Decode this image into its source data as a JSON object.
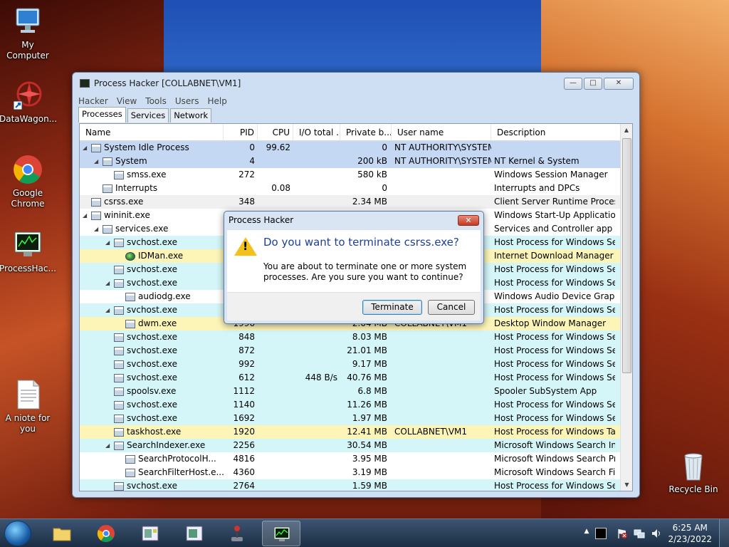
{
  "desktop": {
    "icons": [
      {
        "label": "My Computer"
      },
      {
        "label": "DataWagon..."
      },
      {
        "label": "Google Chrome"
      },
      {
        "label": "ProcessHac..."
      },
      {
        "label": "A niote for you"
      },
      {
        "label": "Recycle Bin"
      }
    ]
  },
  "window": {
    "title": "Process Hacker [COLLABNET\\VM1]",
    "menu": [
      "Hacker",
      "View",
      "Tools",
      "Users",
      "Help"
    ],
    "tabs": [
      "Processes",
      "Services",
      "Network"
    ],
    "columns": [
      "Name",
      "PID",
      "CPU",
      "I/O total ...",
      "Private b...",
      "User name",
      "Description"
    ],
    "rows": [
      {
        "name": "System Idle Process",
        "pid": "0",
        "cpu": "99.62",
        "io": "",
        "priv": "0",
        "user": "NT AUTHORITY\\SYSTEM",
        "desc": "",
        "depth": 0,
        "expanded": "open",
        "color": "#c4d8f4"
      },
      {
        "name": "System",
        "pid": "4",
        "cpu": "",
        "io": "",
        "priv": "200 kB",
        "user": "NT AUTHORITY\\SYSTEM",
        "desc": "NT Kernel & System",
        "depth": 1,
        "expanded": "open",
        "color": "#c4d8f4"
      },
      {
        "name": "smss.exe",
        "pid": "272",
        "cpu": "",
        "io": "",
        "priv": "580 kB",
        "user": "",
        "desc": "Windows Session Manager",
        "depth": 2,
        "expanded": "",
        "color": "#ffffff"
      },
      {
        "name": "Interrupts",
        "pid": "",
        "cpu": "0.08",
        "io": "",
        "priv": "0",
        "user": "",
        "desc": "Interrupts and DPCs",
        "depth": 1,
        "expanded": "",
        "color": "#ffffff"
      },
      {
        "name": "csrss.exe",
        "pid": "348",
        "cpu": "",
        "io": "",
        "priv": "2.34 MB",
        "user": "",
        "desc": "Client Server Runtime Process",
        "depth": 0,
        "expanded": "",
        "color": "#f0f0f0"
      },
      {
        "name": "wininit.exe",
        "pid": "",
        "cpu": "",
        "io": "",
        "priv": "",
        "user": "",
        "desc": "Windows Start-Up Application",
        "depth": 0,
        "expanded": "open",
        "color": "#ffffff"
      },
      {
        "name": "services.exe",
        "pid": "",
        "cpu": "",
        "io": "",
        "priv": "",
        "user": "",
        "desc": "Services and Controller app",
        "depth": 1,
        "expanded": "open",
        "color": "#ffffff"
      },
      {
        "name": "svchost.exe",
        "pid": "",
        "cpu": "",
        "io": "",
        "priv": "",
        "user": "",
        "desc": "Host Process for Windows Ser...",
        "depth": 2,
        "expanded": "open",
        "color": "#d4f6f8"
      },
      {
        "name": "IDMan.exe",
        "pid": "",
        "cpu": "",
        "io": "",
        "priv": "",
        "user": "",
        "desc": "Internet Download Manager (I...",
        "depth": 3,
        "expanded": "",
        "color": "#fdf5b8",
        "icon": "globe"
      },
      {
        "name": "svchost.exe",
        "pid": "",
        "cpu": "",
        "io": "",
        "priv": "",
        "user": "",
        "desc": "Host Process for Windows Ser...",
        "depth": 2,
        "expanded": "",
        "color": "#d4f6f8"
      },
      {
        "name": "svchost.exe",
        "pid": "",
        "cpu": "",
        "io": "",
        "priv": "",
        "user": "",
        "desc": "Host Process for Windows Ser...",
        "depth": 2,
        "expanded": "open",
        "color": "#d4f6f8"
      },
      {
        "name": "audiodg.exe",
        "pid": "",
        "cpu": "",
        "io": "",
        "priv": "",
        "user": "",
        "desc": "Windows Audio Device Graph...",
        "depth": 3,
        "expanded": "",
        "color": "#ffffff"
      },
      {
        "name": "svchost.exe",
        "pid": "",
        "cpu": "",
        "io": "",
        "priv": "",
        "user": "",
        "desc": "Host Process for Windows Ser...",
        "depth": 2,
        "expanded": "open",
        "color": "#d4f6f8"
      },
      {
        "name": "dwm.exe",
        "pid": "1996",
        "cpu": "",
        "io": "",
        "priv": "2.04 MB",
        "user": "COLLABNET\\VM1",
        "desc": "Desktop Window Manager",
        "depth": 3,
        "expanded": "",
        "color": "#fdf5b8"
      },
      {
        "name": "svchost.exe",
        "pid": "848",
        "cpu": "",
        "io": "",
        "priv": "8.03 MB",
        "user": "",
        "desc": "Host Process for Windows Ser...",
        "depth": 2,
        "expanded": "",
        "color": "#d4f6f8"
      },
      {
        "name": "svchost.exe",
        "pid": "872",
        "cpu": "",
        "io": "",
        "priv": "21.01 MB",
        "user": "",
        "desc": "Host Process for Windows Ser...",
        "depth": 2,
        "expanded": "",
        "color": "#d4f6f8"
      },
      {
        "name": "svchost.exe",
        "pid": "992",
        "cpu": "",
        "io": "",
        "priv": "9.17 MB",
        "user": "",
        "desc": "Host Process for Windows Ser...",
        "depth": 2,
        "expanded": "",
        "color": "#d4f6f8"
      },
      {
        "name": "svchost.exe",
        "pid": "612",
        "cpu": "",
        "io": "448 B/s",
        "priv": "40.76 MB",
        "user": "",
        "desc": "Host Process for Windows Ser...",
        "depth": 2,
        "expanded": "",
        "color": "#d4f6f8"
      },
      {
        "name": "spoolsv.exe",
        "pid": "1112",
        "cpu": "",
        "io": "",
        "priv": "6.8 MB",
        "user": "",
        "desc": "Spooler SubSystem App",
        "depth": 2,
        "expanded": "",
        "color": "#d4f6f8"
      },
      {
        "name": "svchost.exe",
        "pid": "1140",
        "cpu": "",
        "io": "",
        "priv": "11.26 MB",
        "user": "",
        "desc": "Host Process for Windows Ser...",
        "depth": 2,
        "expanded": "",
        "color": "#d4f6f8"
      },
      {
        "name": "svchost.exe",
        "pid": "1692",
        "cpu": "",
        "io": "",
        "priv": "1.97 MB",
        "user": "",
        "desc": "Host Process for Windows Ser...",
        "depth": 2,
        "expanded": "",
        "color": "#d4f6f8"
      },
      {
        "name": "taskhost.exe",
        "pid": "1920",
        "cpu": "",
        "io": "",
        "priv": "12.41 MB",
        "user": "COLLABNET\\VM1",
        "desc": "Host Process for Windows Tas...",
        "depth": 2,
        "expanded": "",
        "color": "#fdf5b8"
      },
      {
        "name": "SearchIndexer.exe",
        "pid": "2256",
        "cpu": "",
        "io": "",
        "priv": "30.54 MB",
        "user": "",
        "desc": "Microsoft Windows Search In...",
        "depth": 2,
        "expanded": "open",
        "color": "#d4f6f8"
      },
      {
        "name": "SearchProtocolH...",
        "pid": "4816",
        "cpu": "",
        "io": "",
        "priv": "3.95 MB",
        "user": "",
        "desc": "Microsoft Windows Search Pr...",
        "depth": 3,
        "expanded": "",
        "color": "#ffffff"
      },
      {
        "name": "SearchFilterHost.e...",
        "pid": "4360",
        "cpu": "",
        "io": "",
        "priv": "3.19 MB",
        "user": "",
        "desc": "Microsoft Windows Search Fil...",
        "depth": 3,
        "expanded": "",
        "color": "#ffffff"
      },
      {
        "name": "svchost.exe",
        "pid": "2764",
        "cpu": "",
        "io": "",
        "priv": "1.59 MB",
        "user": "",
        "desc": "Host Process for Windows Ser...",
        "depth": 2,
        "expanded": "",
        "color": "#d4f6f8"
      }
    ]
  },
  "dialog": {
    "title": "Process Hacker",
    "heading": "Do you want to terminate csrss.exe?",
    "message": "You are about to terminate one or more system processes. Are you sure you want to continue?",
    "terminate_label": "Terminate",
    "cancel_label": "Cancel"
  },
  "taskbar": {
    "time": "6:25 AM",
    "date": "2/23/2022"
  }
}
